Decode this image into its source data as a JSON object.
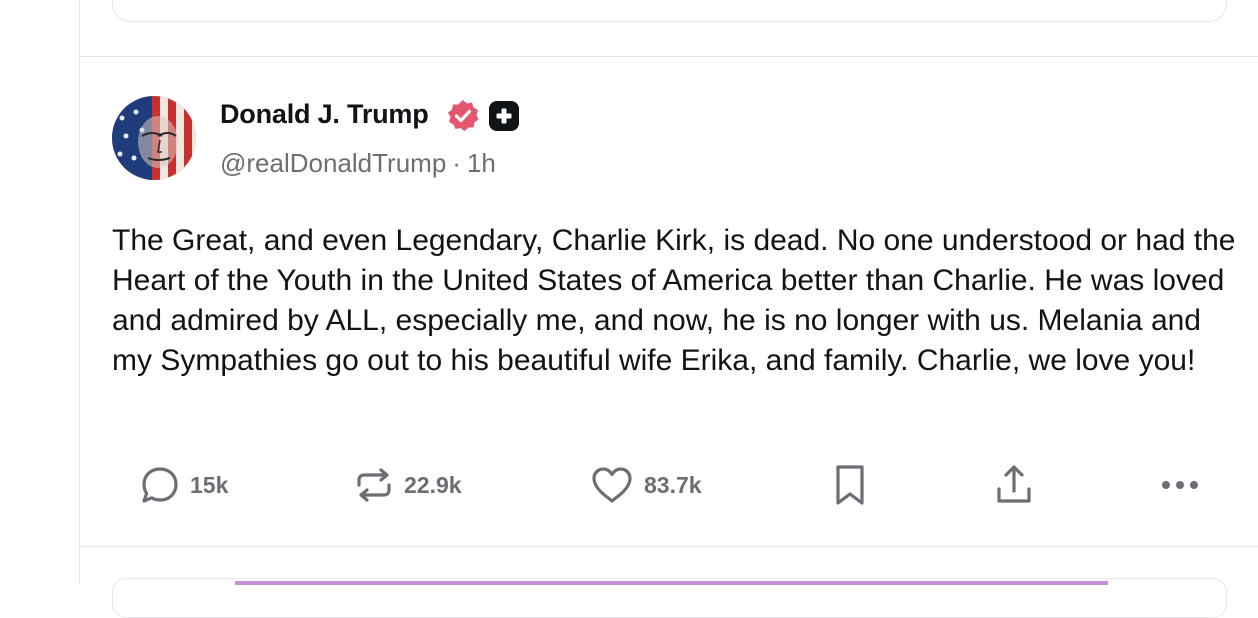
{
  "post": {
    "author_name": "Donald J. Trump",
    "handle": "@realDonaldTrump",
    "separator": "·",
    "time": "1h",
    "text": "The Great, and even Legendary, Charlie Kirk, is dead. No one understood or had the Heart of the Youth in the United States of America better than Charlie. He was loved and admired by ALL, especially me, and now, he is no longer with us. Melania and my Sympathies go out to his beautiful wife Erika, and family. Charlie, we love you!",
    "badges": {
      "verified_icon": "verified-seal-icon",
      "verified_color": "#e5566f",
      "plus_icon": "plus-square-icon"
    }
  },
  "actions": {
    "replies": "15k",
    "reposts": "22.9k",
    "likes": "83.7k",
    "icons": [
      "comment-icon",
      "repost-icon",
      "heart-icon",
      "bookmark-icon",
      "share-icon",
      "more-icon"
    ]
  },
  "colors": {
    "text": "#0f1419",
    "muted": "#6b6f75",
    "border": "#e6e7ea",
    "accent": "#e5566f"
  }
}
